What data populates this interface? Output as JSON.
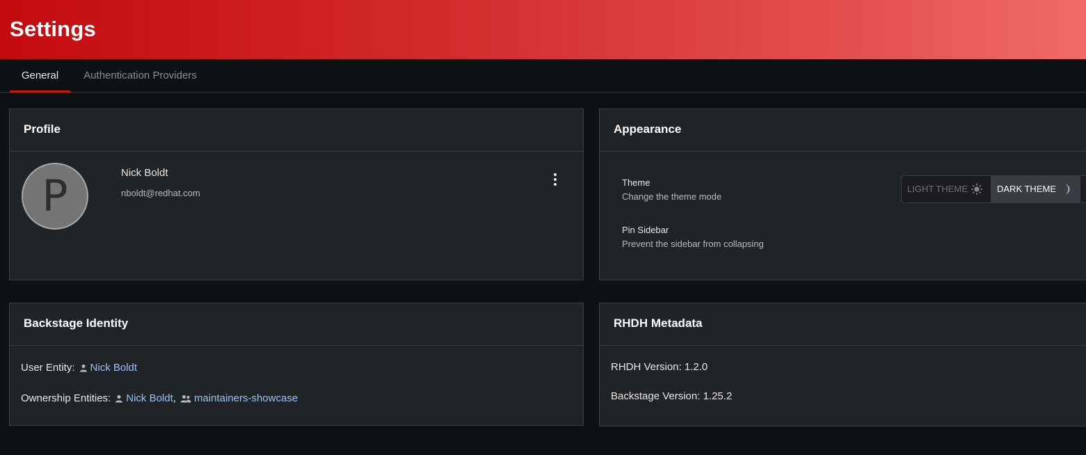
{
  "header": {
    "title": "Settings"
  },
  "tabs": [
    {
      "label": "General",
      "active": true
    },
    {
      "label": "Authentication Providers",
      "active": false
    }
  ],
  "profile": {
    "title": "Profile",
    "avatar_letter": "P",
    "name": "Nick Boldt",
    "email": "nboldt@redhat.com",
    "menu_icon": "kebab-menu-icon"
  },
  "appearance": {
    "title": "Appearance",
    "theme_label": "Theme",
    "theme_desc": "Change the theme mode",
    "theme_options": [
      {
        "label": "LIGHT THEME",
        "icon": "sun-icon",
        "selected": false
      },
      {
        "label": "DARK THEME",
        "icon": "moon-icon",
        "selected": true
      }
    ],
    "pin_label": "Pin Sidebar",
    "pin_desc": "Prevent the sidebar from collapsing"
  },
  "identity": {
    "title": "Backstage Identity",
    "user_entity_label": "User Entity:",
    "user_entity": "Nick Boldt",
    "ownership_label": "Ownership Entities:",
    "ownership": [
      {
        "name": "Nick Boldt",
        "icon": "user-icon"
      },
      {
        "name": "maintainers-showcase",
        "icon": "group-icon"
      }
    ],
    "separator": ","
  },
  "metadata": {
    "title": "RHDH Metadata",
    "rhdh_version": "RHDH Version: 1.2.0",
    "backstage_version": "Backstage Version: 1.25.2"
  },
  "colors": {
    "header_gradient_start": "#c30b0f",
    "header_gradient_end": "#f06a6a",
    "tab_underline": "#c9190b",
    "link": "#9ac2f2",
    "card_bg": "#212427",
    "page_bg": "#0f1214"
  }
}
